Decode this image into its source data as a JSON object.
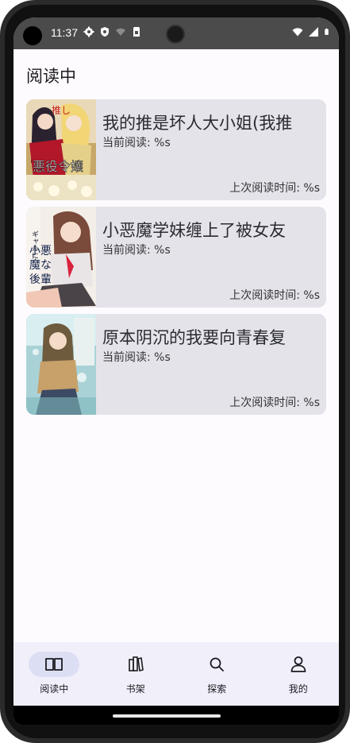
{
  "status_bar": {
    "time": "11:37"
  },
  "header": {
    "title": "阅读中"
  },
  "books": [
    {
      "title": "我的推是坏人大小姐(我推",
      "progress": "当前阅读: %s",
      "last_read": "上次阅读时间: %s"
    },
    {
      "title": "小恶魔学妹缠上了被女友",
      "progress": "当前阅读: %s",
      "last_read": "上次阅读时间: %s"
    },
    {
      "title": "原本阴沉的我要向青春复",
      "progress": "当前阅读: %s",
      "last_read": "上次阅读时间: %s"
    }
  ],
  "bottom_nav": {
    "items": [
      {
        "label": "阅读中",
        "icon": "book-open-icon",
        "active": true
      },
      {
        "label": "书架",
        "icon": "bookshelf-icon",
        "active": false
      },
      {
        "label": "探索",
        "icon": "search-icon",
        "active": false
      },
      {
        "label": "我的",
        "icon": "person-icon",
        "active": false
      }
    ]
  },
  "colors": {
    "background": "#fefbff",
    "card": "#e4e3ea",
    "nav_bg": "#f1effa",
    "nav_active": "#dcdff3",
    "status_bar": "#4b4b4b"
  }
}
